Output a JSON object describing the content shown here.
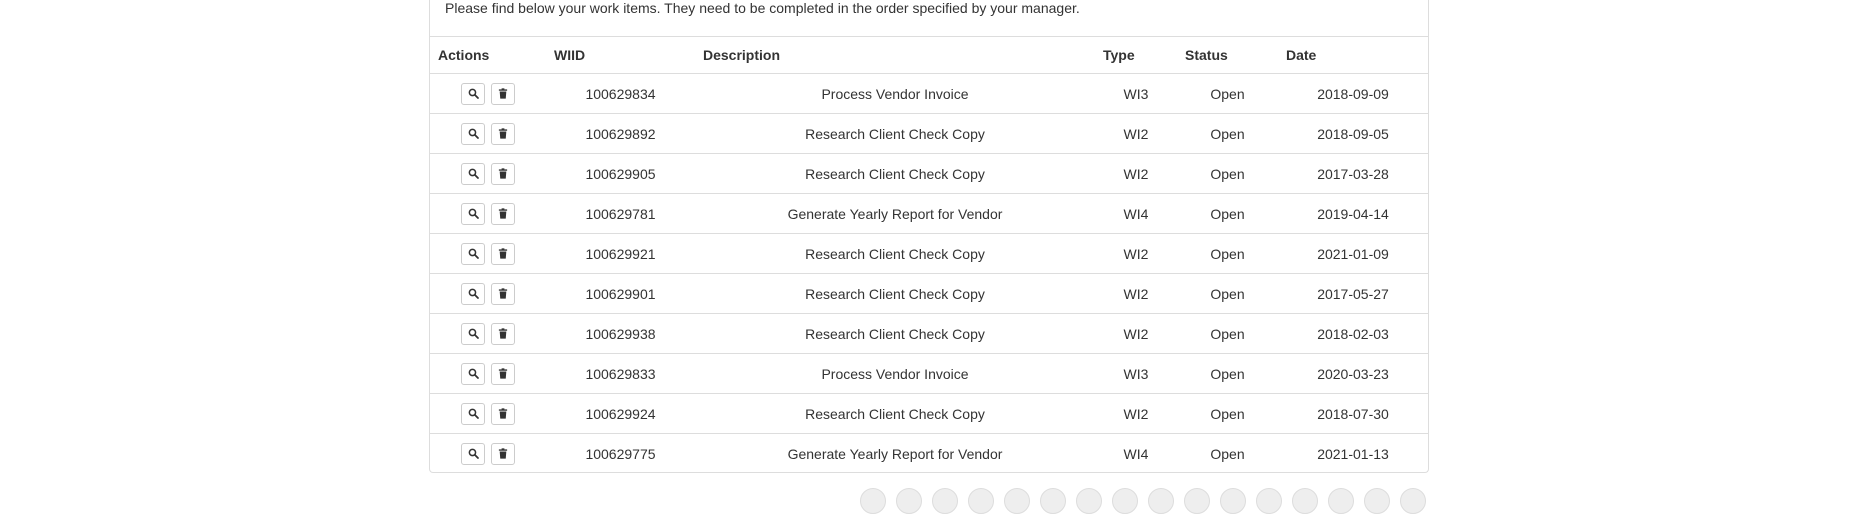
{
  "intro_text": "Please find below your work items. They need to be completed in the order specified by your manager.",
  "table": {
    "headers": {
      "actions": "Actions",
      "wiid": "WIID",
      "description": "Description",
      "type": "Type",
      "status": "Status",
      "date": "Date"
    },
    "rows": [
      {
        "wiid": "100629834",
        "description": "Process Vendor Invoice",
        "type": "WI3",
        "status": "Open",
        "date": "2018-09-09"
      },
      {
        "wiid": "100629892",
        "description": "Research Client Check Copy",
        "type": "WI2",
        "status": "Open",
        "date": "2018-09-05"
      },
      {
        "wiid": "100629905",
        "description": "Research Client Check Copy",
        "type": "WI2",
        "status": "Open",
        "date": "2017-03-28"
      },
      {
        "wiid": "100629781",
        "description": "Generate Yearly Report for Vendor",
        "type": "WI4",
        "status": "Open",
        "date": "2019-04-14"
      },
      {
        "wiid": "100629921",
        "description": "Research Client Check Copy",
        "type": "WI2",
        "status": "Open",
        "date": "2021-01-09"
      },
      {
        "wiid": "100629901",
        "description": "Research Client Check Copy",
        "type": "WI2",
        "status": "Open",
        "date": "2017-05-27"
      },
      {
        "wiid": "100629938",
        "description": "Research Client Check Copy",
        "type": "WI2",
        "status": "Open",
        "date": "2018-02-03"
      },
      {
        "wiid": "100629833",
        "description": "Process Vendor Invoice",
        "type": "WI3",
        "status": "Open",
        "date": "2020-03-23"
      },
      {
        "wiid": "100629924",
        "description": "Research Client Check Copy",
        "type": "WI2",
        "status": "Open",
        "date": "2018-07-30"
      },
      {
        "wiid": "100629775",
        "description": "Generate Yearly Report for Vendor",
        "type": "WI4",
        "status": "Open",
        "date": "2021-01-13"
      }
    ],
    "row_actions": [
      {
        "icon": "search-icon",
        "action": "view"
      },
      {
        "icon": "trash-icon",
        "action": "delete"
      }
    ]
  },
  "pagination": {
    "visible_page_buttons": 16
  },
  "colors": {
    "border": "#dddddd",
    "text": "#333333",
    "button_border": "#cccccc"
  }
}
